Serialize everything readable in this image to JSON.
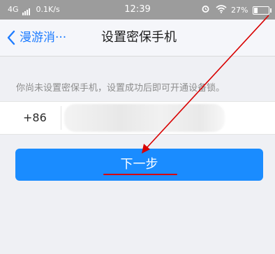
{
  "status_bar": {
    "network": "4G",
    "speed": "0.1K/s",
    "time": "12:39",
    "battery": "27%",
    "battery_level": 0.27
  },
  "nav": {
    "back_label": "漫游消···",
    "title": "设置密保手机"
  },
  "form": {
    "hint": "你尚未设置密保手机，设置成功后即可开通设备锁。",
    "country_code": "+86",
    "phone_value": ""
  },
  "actions": {
    "next_label": "下一步"
  },
  "colors": {
    "accent": "#1a8cff",
    "annotation": "#d80000"
  }
}
